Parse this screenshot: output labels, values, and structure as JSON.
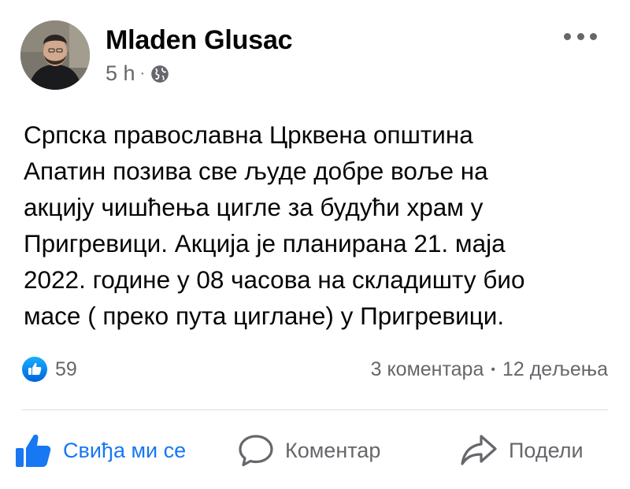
{
  "post": {
    "author": "Mladen Glusac",
    "time": "5 h",
    "dot": "·",
    "privacy_icon": "globe-icon",
    "more_icon": "more-options-icon",
    "text_lines": [
      "Српска православна Црквена општина",
      "Апатин позива све људе добре воље на",
      "акцију чишћења цигле за будући храм у",
      "Пригревици. Акција је планирана 21. маја",
      "2022. године у 08 часова на складишту био",
      "масе ( преко пута циглане) у Пригревици."
    ]
  },
  "stats": {
    "reaction_icon": "like-reaction-icon",
    "reaction_count": "59",
    "comments": "3 коментара",
    "separator": "•",
    "shares": "12 дељења"
  },
  "actions": {
    "like_label": "Свиђа ми се",
    "comment_label": "Коментар",
    "share_label": "Подели"
  },
  "colors": {
    "accent": "#1877f2",
    "secondary_text": "#65676b",
    "primary_text": "#050505",
    "divider": "#dadde1"
  }
}
